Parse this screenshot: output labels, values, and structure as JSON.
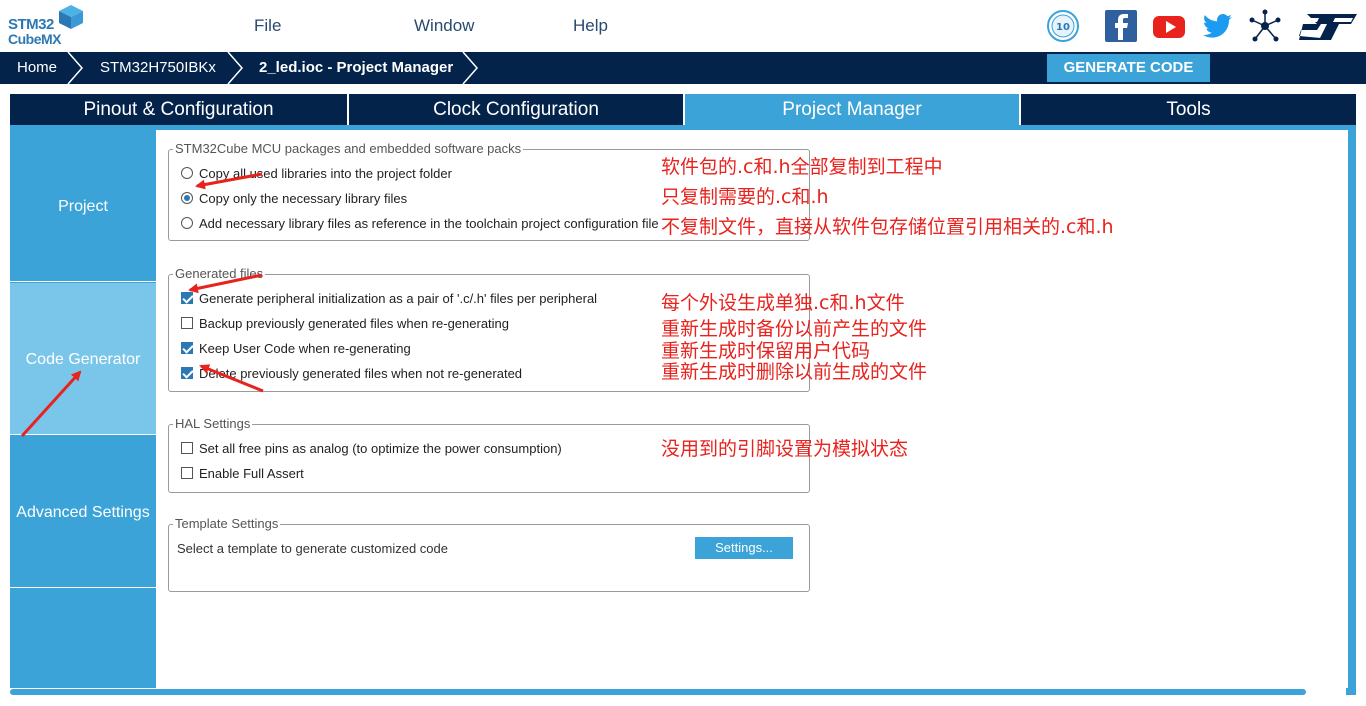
{
  "app": {
    "logo_line1": "STM32",
    "logo_line2": "CubeMX"
  },
  "menu": {
    "file": "File",
    "window": "Window",
    "help": "Help"
  },
  "social_icons": [
    "anniversary-badge-icon",
    "facebook-icon",
    "youtube-icon",
    "twitter-icon",
    "network-icon",
    "st-logo-icon"
  ],
  "badge_text": "10",
  "breadcrumb": {
    "home": "Home",
    "mcu": "STM32H750IBKx",
    "project": "2_led.ioc - Project Manager"
  },
  "generate_button": "GENERATE CODE",
  "tabs": [
    {
      "label": "Pinout & Configuration"
    },
    {
      "label": "Clock Configuration"
    },
    {
      "label": "Project Manager"
    },
    {
      "label": "Tools"
    }
  ],
  "sidebar": {
    "items": [
      {
        "label": "Project"
      },
      {
        "label": "Code Generator"
      },
      {
        "label": "Advanced Settings"
      }
    ]
  },
  "packages": {
    "title": "STM32Cube MCU packages and embedded software packs",
    "options": [
      {
        "label": "Copy all used libraries into the project folder",
        "selected": false
      },
      {
        "label": "Copy only the necessary library files",
        "selected": true
      },
      {
        "label": "Add necessary library files as reference in the toolchain project configuration file",
        "selected": false
      }
    ]
  },
  "generated": {
    "title": "Generated files",
    "options": [
      {
        "label": "Generate peripheral initialization as a pair of '.c/.h' files per peripheral",
        "checked": true
      },
      {
        "label": "Backup previously generated files when re-generating",
        "checked": false
      },
      {
        "label": "Keep User Code when re-generating",
        "checked": true
      },
      {
        "label": "Delete previously generated files when not re-generated",
        "checked": true
      }
    ]
  },
  "hal": {
    "title": "HAL Settings",
    "options": [
      {
        "label": "Set all free pins as analog (to optimize the power consumption)",
        "checked": false
      },
      {
        "label": "Enable Full Assert",
        "checked": false
      }
    ]
  },
  "template": {
    "title": "Template Settings",
    "text": "Select a template to generate customized code",
    "button": "Settings..."
  },
  "annotations": {
    "copy_all": "软件包的.c和.h全部复制到工程中",
    "copy_necessary": "只复制需要的.c和.h",
    "reference": "不复制文件，直接从软件包存储位置引用相关的.c和.h",
    "per_peripheral": "每个外设生成单独.c和.h文件",
    "backup": "重新生成时备份以前产生的文件",
    "keep_user": "重新生成时保留用户代码",
    "delete_old": "重新生成时删除以前生成的文件",
    "analog": "没用到的引脚设置为模拟状态"
  },
  "colors": {
    "navy": "#03234b",
    "accent": "#3ba3d8",
    "sidebar_active": "#7ac6ea",
    "annotation_red": "#e8231e"
  }
}
